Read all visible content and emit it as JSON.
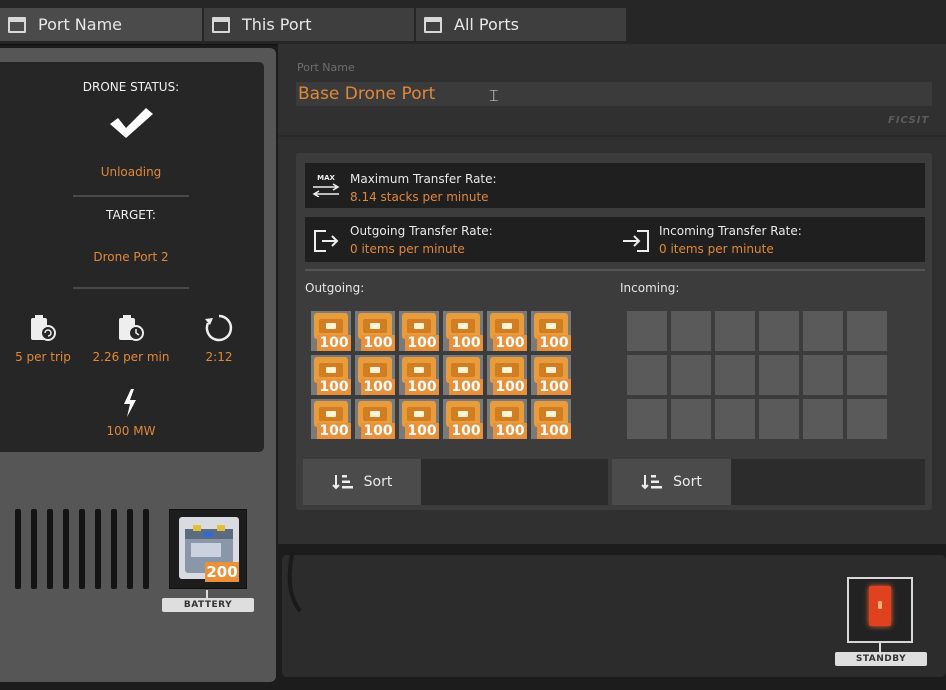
{
  "tabs": [
    {
      "label": "Port Name",
      "state": "active"
    },
    {
      "label": "This Port",
      "state": "inactive"
    },
    {
      "label": "All Ports",
      "state": "inactive"
    }
  ],
  "drone": {
    "status_label": "DRONE STATUS:",
    "status_icon": "checkmark-icon",
    "status_value": "Unloading",
    "target_label": "TARGET:",
    "target_value": "Drone Port 2",
    "stats": [
      {
        "icon": "battery-trip-icon",
        "value": "5 per trip"
      },
      {
        "icon": "battery-rate-icon",
        "value": "2.26 per min"
      },
      {
        "icon": "round-trip-icon",
        "value": "2:12"
      }
    ],
    "power_icon": "lightning-icon",
    "power_value": "100 MW"
  },
  "battery": {
    "count": "200",
    "label": "BATTERY"
  },
  "port": {
    "name_label": "Port Name",
    "name_value": "Base Drone Port",
    "brand": "FICSIT"
  },
  "rates": {
    "max_icon_text": "MAX",
    "max_title": "Maximum Transfer Rate:",
    "max_value": "8.14 stacks per minute",
    "outgoing_title": "Outgoing Transfer Rate:",
    "outgoing_value": "0 items per minute",
    "incoming_title": "Incoming Transfer Rate:",
    "incoming_value": "0 items per minute"
  },
  "outgoing": {
    "label": "Outgoing:",
    "item_icon": "battery-crate-icon",
    "slots": [
      "100",
      "100",
      "100",
      "100",
      "100",
      "100",
      "100",
      "100",
      "100",
      "100",
      "100",
      "100",
      "100",
      "100",
      "100",
      "100",
      "100",
      "100"
    ],
    "sort_label": "Sort"
  },
  "incoming": {
    "label": "Incoming:",
    "slots": [
      "",
      "",
      "",
      "",
      "",
      "",
      "",
      "",
      "",
      "",
      "",
      "",
      "",
      "",
      "",
      "",
      "",
      ""
    ],
    "sort_label": "Sort"
  },
  "standby": {
    "label": "STANDBY"
  },
  "colors": {
    "accent": "#e0883a",
    "badge": "#e8913a",
    "standby": "#e0421f"
  }
}
